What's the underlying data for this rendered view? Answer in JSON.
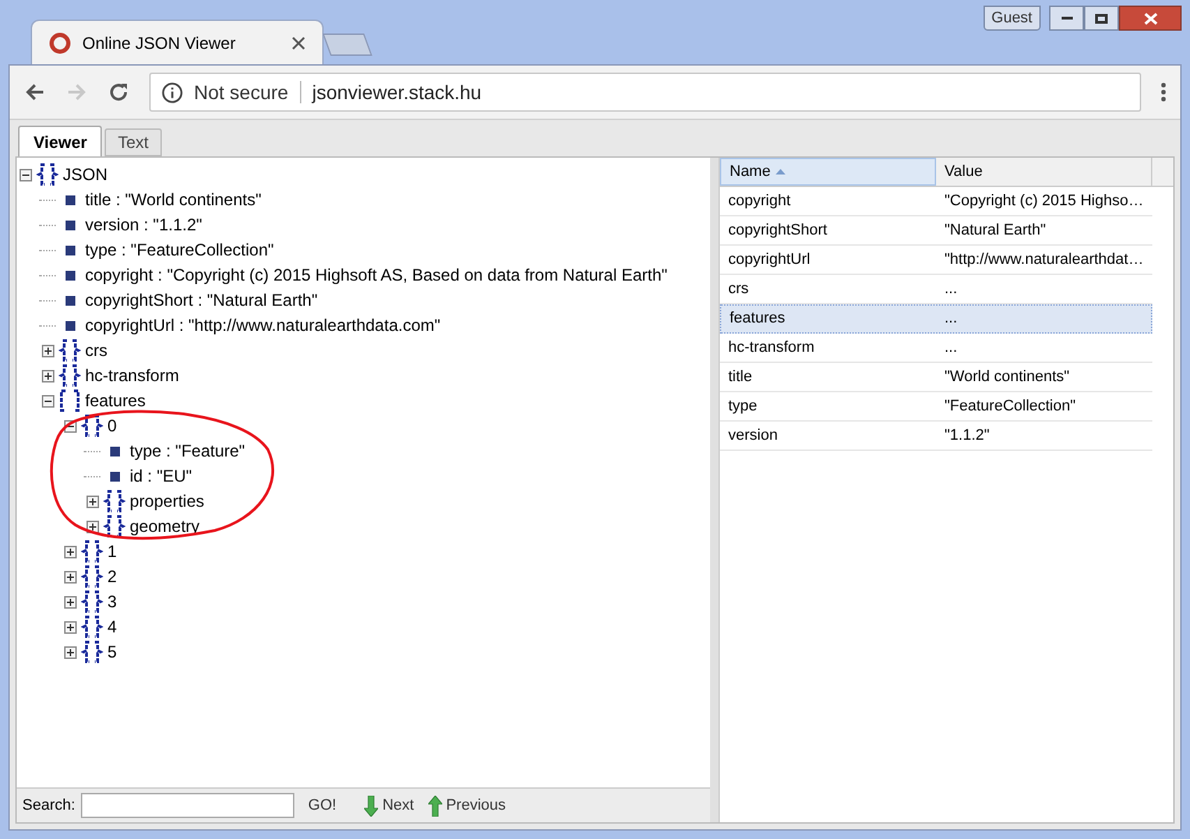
{
  "browser": {
    "user": "Guest",
    "tab_title": "Online JSON Viewer",
    "security": "Not secure",
    "url": "jsonviewer.stack.hu"
  },
  "view_tabs": [
    {
      "label": "Viewer",
      "selected": true
    },
    {
      "label": "Text",
      "selected": false
    }
  ],
  "tree": [
    {
      "kind": "object",
      "label": "JSON",
      "expanded": true,
      "children": [
        {
          "kind": "value",
          "label": "title : \"World continents\""
        },
        {
          "kind": "value",
          "label": "version : \"1.1.2\""
        },
        {
          "kind": "value",
          "label": "type : \"FeatureCollection\""
        },
        {
          "kind": "value",
          "label": "copyright : \"Copyright (c) 2015 Highsoft AS, Based on data from Natural Earth\""
        },
        {
          "kind": "value",
          "label": "copyrightShort : \"Natural Earth\""
        },
        {
          "kind": "value",
          "label": "copyrightUrl : \"http://www.naturalearthdata.com\""
        },
        {
          "kind": "object",
          "label": "crs",
          "expanded": false
        },
        {
          "kind": "object",
          "label": "hc-transform",
          "expanded": false
        },
        {
          "kind": "array",
          "label": "features",
          "expanded": true,
          "children": [
            {
              "kind": "object",
              "label": "0",
              "expanded": true,
              "children": [
                {
                  "kind": "value",
                  "label": "type : \"Feature\""
                },
                {
                  "kind": "value",
                  "label": "id : \"EU\""
                },
                {
                  "kind": "object",
                  "label": "properties",
                  "expanded": false
                },
                {
                  "kind": "object",
                  "label": "geometry",
                  "expanded": false
                }
              ]
            },
            {
              "kind": "object",
              "label": "1",
              "expanded": false
            },
            {
              "kind": "object",
              "label": "2",
              "expanded": false
            },
            {
              "kind": "object",
              "label": "3",
              "expanded": false
            },
            {
              "kind": "object",
              "label": "4",
              "expanded": false
            },
            {
              "kind": "object",
              "label": "5",
              "expanded": false
            }
          ]
        }
      ]
    }
  ],
  "annotation": {
    "kind": "circle",
    "color": "#e8141c"
  },
  "table": {
    "columns": [
      {
        "label": "Name",
        "sorted": true
      },
      {
        "label": "Value",
        "sorted": false
      }
    ],
    "rows": [
      {
        "name": "copyright",
        "value": "\"Copyright (c) 2015 Highso…",
        "selected": false
      },
      {
        "name": "copyrightShort",
        "value": "\"Natural Earth\"",
        "selected": false
      },
      {
        "name": "copyrightUrl",
        "value": "\"http://www.naturalearthdat…",
        "selected": false
      },
      {
        "name": "crs",
        "value": "...",
        "selected": false
      },
      {
        "name": "features",
        "value": "...",
        "selected": true
      },
      {
        "name": "hc-transform",
        "value": "...",
        "selected": false
      },
      {
        "name": "title",
        "value": "\"World continents\"",
        "selected": false
      },
      {
        "name": "type",
        "value": "\"FeatureCollection\"",
        "selected": false
      },
      {
        "name": "version",
        "value": "\"1.1.2\"",
        "selected": false
      }
    ]
  },
  "search": {
    "label": "Search:",
    "go": "GO!",
    "next": "Next",
    "previous": "Previous"
  }
}
